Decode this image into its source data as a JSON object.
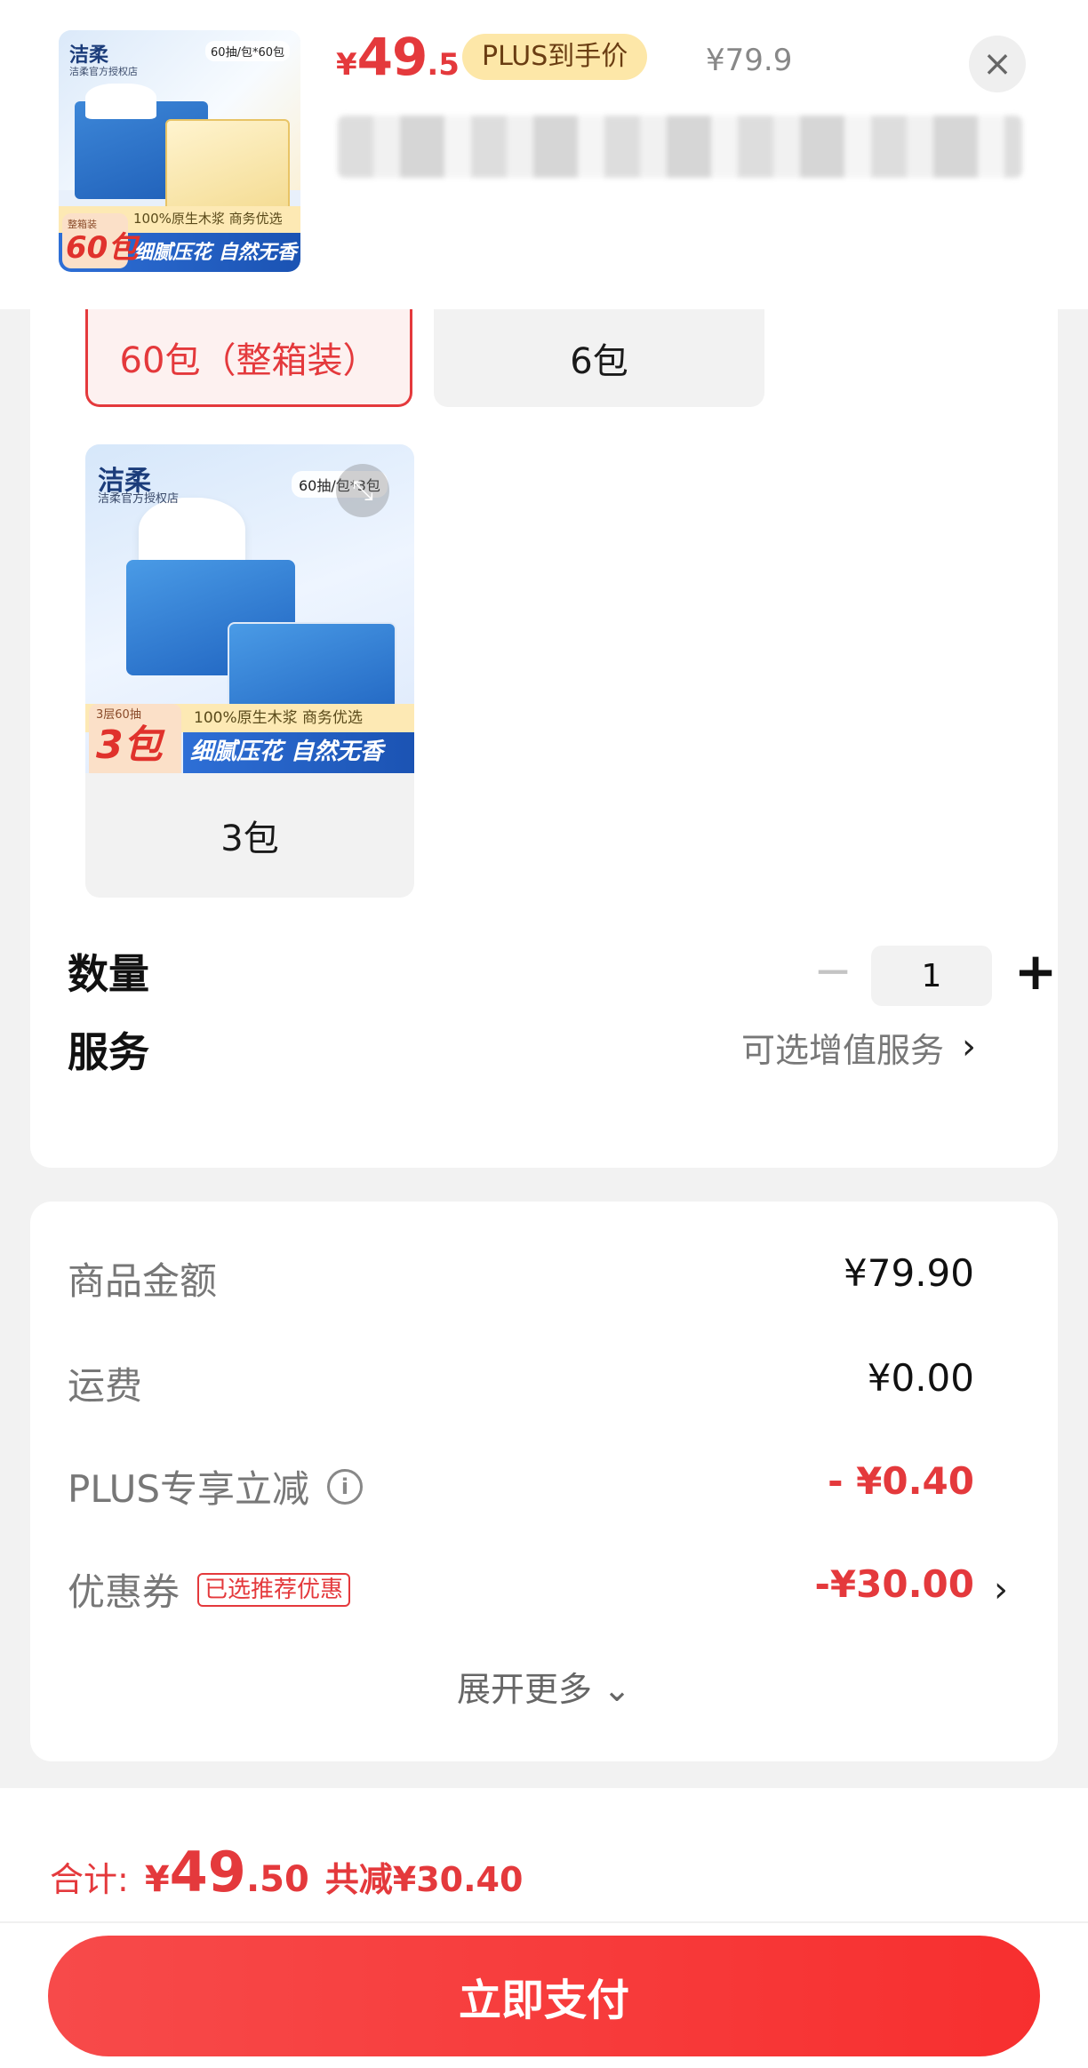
{
  "header": {
    "thumbnail": {
      "brand": "洁柔",
      "shop": "洁柔官方授权店",
      "spec": "60抽/包*60包",
      "strip": "100%原生木浆 商务优选",
      "banner": "细腻压花 自然无香",
      "count_sub": "整箱装",
      "count": "60包"
    },
    "price_symbol": "¥",
    "price_int": "49",
    "price_dec": ".5",
    "plus_badge": "PLUS到手价",
    "original_price": "¥79.9",
    "close_icon": "×"
  },
  "specs": {
    "options": [
      {
        "label": "60包（整箱装）",
        "selected": true
      },
      {
        "label": "6包",
        "selected": false
      }
    ],
    "card": {
      "label": "3包",
      "brand": "洁柔",
      "shop": "洁柔官方授权店",
      "spec": "60抽/包*3包",
      "strip": "100%原生木浆 商务优选",
      "banner": "细腻压花 自然无香",
      "count_sub": "3层60抽",
      "count": "3包",
      "expand_icon": "⤡"
    }
  },
  "quantity": {
    "label": "数量",
    "value": "1",
    "minus": "−",
    "plus": "+"
  },
  "service": {
    "label": "服务",
    "link": "可选增值服务",
    "chevron": "›"
  },
  "fees": {
    "goods_label": "商品金额",
    "goods_value": "¥79.90",
    "shipping_label": "运费",
    "shipping_value": "¥0.00",
    "plus_label": "PLUS专享立减",
    "plus_info": "i",
    "plus_value": "- ¥0.40",
    "coupon_label": "优惠券",
    "coupon_tag": "已选推荐优惠",
    "coupon_value": "-¥30.00",
    "coupon_chevron": "›",
    "more": "展开更多 ⌄"
  },
  "footer": {
    "total_label": "合计:",
    "total_symbol": "¥",
    "total_int": "49",
    "total_dec": ".50",
    "savings": "共减¥30.40",
    "pay_button": "立即支付"
  },
  "colors": {
    "accent": "#e4393c",
    "plus_badge_bg": "#fde7a8"
  }
}
